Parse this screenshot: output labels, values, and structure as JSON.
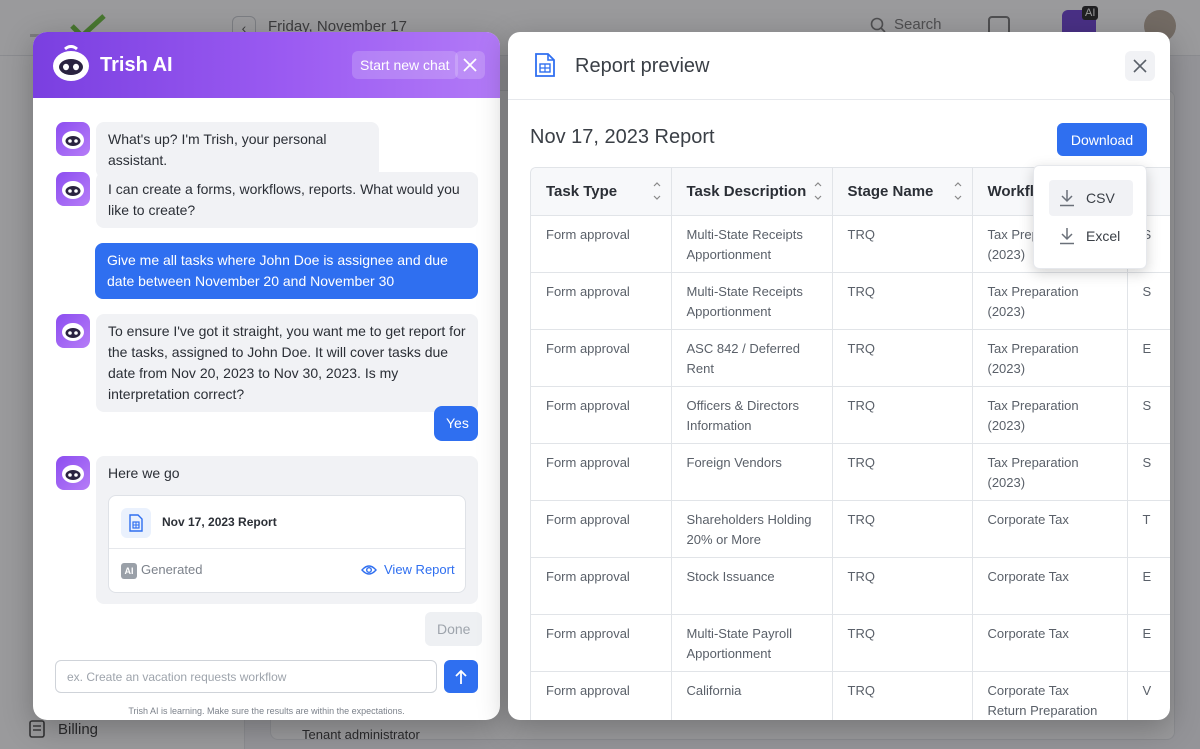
{
  "background": {
    "date": "Friday, November 17",
    "search_label": "Search",
    "ai_badge": "AI",
    "billing_label": "Billing",
    "tenant_label": "Tenant administrator"
  },
  "chat": {
    "title": "Trish AI",
    "new_chat_label": "Start new chat",
    "messages": {
      "m1": "What's up? I'm Trish, your personal assistant.",
      "m2": "I can create a forms, workflows, reports. What would you like to create?",
      "u1": "Give me all tasks where John Doe is assignee and due date between November 20 and November 30",
      "m3": "To ensure I've got it straight, you want me to get report for the tasks, assigned to John Doe. It will cover tasks due date from Nov 20, 2023 to Nov 30, 2023. Is my interpretation correct?",
      "u2": "Yes",
      "m4": "Here we go"
    },
    "report_card": {
      "title": "Nov 17, 2023 Report",
      "ai_chip": "AI",
      "generated_label": "Generated",
      "view_label": "View Report"
    },
    "done_label": "Done",
    "input_placeholder": "ex. Create an vacation requests workflow",
    "disclaimer": "Trish AI is learning. Make sure the results are within the expectations."
  },
  "preview": {
    "title": "Report preview",
    "report_heading": "Nov 17, 2023 Report",
    "download_label": "Download",
    "download_menu": {
      "csv": "CSV",
      "excel": "Excel"
    },
    "columns": [
      "Task Type",
      "Task Description",
      "Stage Name",
      "Workflow",
      ""
    ],
    "rows": [
      [
        "Form approval",
        "Multi-State Receipts Apportionment",
        "TRQ",
        "Tax Preparation (2023)",
        "S"
      ],
      [
        "Form approval",
        "Multi-State Receipts Apportionment",
        "TRQ",
        "Tax Preparation (2023)",
        "S"
      ],
      [
        "Form approval",
        "ASC 842 / Deferred Rent",
        "TRQ",
        "Tax Preparation (2023)",
        "E"
      ],
      [
        "Form approval",
        "Officers & Directors Information",
        "TRQ",
        "Tax Preparation (2023)",
        "S"
      ],
      [
        "Form approval",
        "Foreign Vendors",
        "TRQ",
        "Tax Preparation (2023)",
        "S"
      ],
      [
        "Form approval",
        "Shareholders Holding 20% or More",
        "TRQ",
        "Corporate Tax",
        "T"
      ],
      [
        "Form approval",
        "Stock Issuance",
        "TRQ",
        "Corporate Tax",
        "E"
      ],
      [
        "Form approval",
        "Multi-State Payroll Apportionment",
        "TRQ",
        "Corporate Tax",
        "E"
      ],
      [
        "Form approval",
        "California",
        "TRQ",
        "Corporate Tax Return Preparation",
        "V"
      ]
    ]
  },
  "colors": {
    "accent": "#2f6ff0",
    "brand_purple": "#7a3fe0"
  }
}
